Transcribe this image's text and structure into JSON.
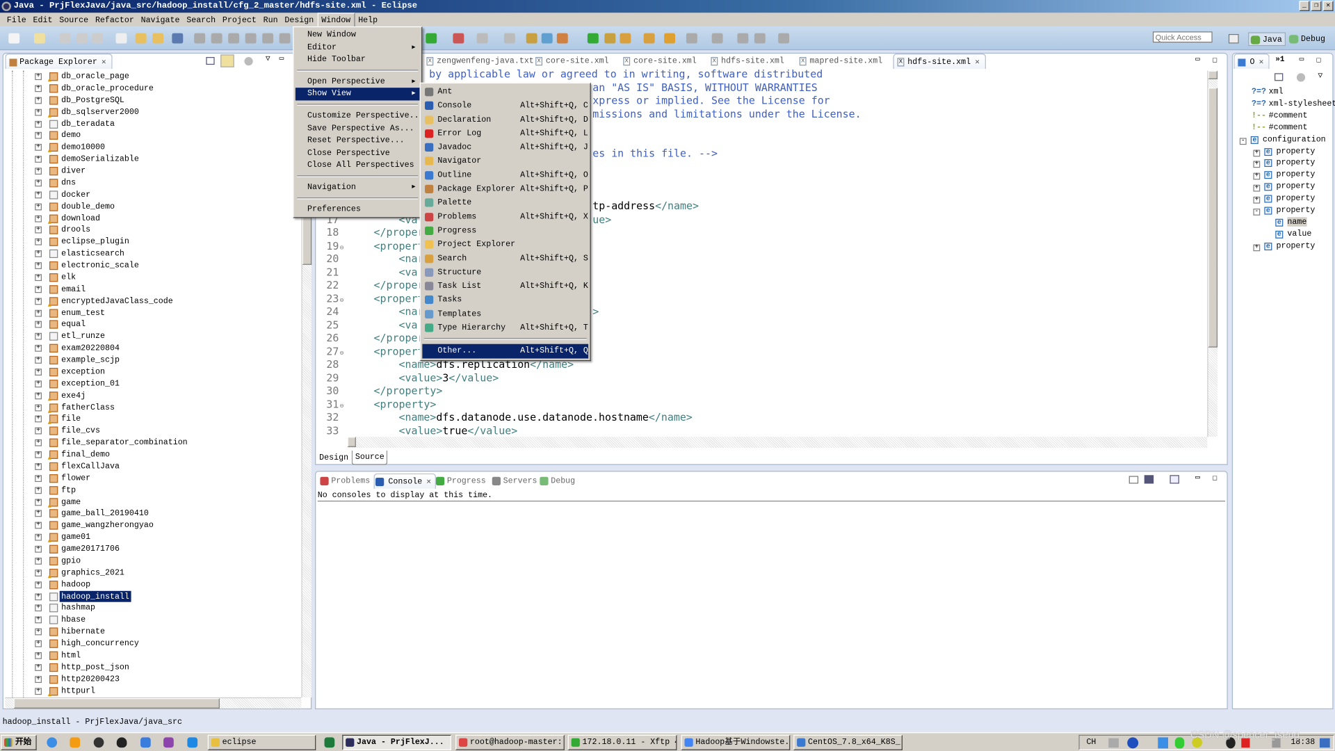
{
  "window": {
    "title": "Java - PrjFlexJava/java_src/hadoop_install/cfg_2_master/hdfs-site.xml - Eclipse"
  },
  "menubar": [
    "File",
    "Edit",
    "Source",
    "Refactor",
    "Navigate",
    "Search",
    "Project",
    "Run",
    "Design",
    "Window",
    "Help"
  ],
  "toolbar": {
    "quick_access_placeholder": "Quick Access",
    "perspectives": [
      {
        "label": "Java",
        "active": true
      },
      {
        "label": "Debug",
        "active": false
      }
    ]
  },
  "package_explorer": {
    "title": "Package Explorer",
    "items": [
      {
        "label": "db_oracle_page",
        "type": "project-warn"
      },
      {
        "label": "db_oracle_procedure",
        "type": "project"
      },
      {
        "label": "db_PostgreSQL",
        "type": "project"
      },
      {
        "label": "db_sqlserver2000",
        "type": "project-warn"
      },
      {
        "label": "db_teradata",
        "type": "folder"
      },
      {
        "label": "demo",
        "type": "project"
      },
      {
        "label": "demo10000",
        "type": "project-warn"
      },
      {
        "label": "demoSerializable",
        "type": "project"
      },
      {
        "label": "diver",
        "type": "project"
      },
      {
        "label": "dns",
        "type": "project"
      },
      {
        "label": "docker",
        "type": "folder"
      },
      {
        "label": "double_demo",
        "type": "project"
      },
      {
        "label": "download",
        "type": "project-warn"
      },
      {
        "label": "drools",
        "type": "project"
      },
      {
        "label": "eclipse_plugin",
        "type": "project"
      },
      {
        "label": "elasticsearch",
        "type": "folder"
      },
      {
        "label": "electronic_scale",
        "type": "project"
      },
      {
        "label": "elk",
        "type": "project"
      },
      {
        "label": "email",
        "type": "project"
      },
      {
        "label": "encryptedJavaClass_code",
        "type": "project-warn"
      },
      {
        "label": "enum_test",
        "type": "project"
      },
      {
        "label": "equal",
        "type": "project"
      },
      {
        "label": "etl_runze",
        "type": "folder"
      },
      {
        "label": "exam20220804",
        "type": "project"
      },
      {
        "label": "example_scjp",
        "type": "project"
      },
      {
        "label": "exception",
        "type": "project"
      },
      {
        "label": "exception_01",
        "type": "project"
      },
      {
        "label": "exe4j",
        "type": "project-warn"
      },
      {
        "label": "fatherClass",
        "type": "project-warn"
      },
      {
        "label": "file",
        "type": "project-warn"
      },
      {
        "label": "file_cvs",
        "type": "project"
      },
      {
        "label": "file_separator_combination",
        "type": "project"
      },
      {
        "label": "final_demo",
        "type": "project-warn"
      },
      {
        "label": "flexCallJava",
        "type": "project"
      },
      {
        "label": "flower",
        "type": "project"
      },
      {
        "label": "ftp",
        "type": "project"
      },
      {
        "label": "game",
        "type": "project-warn"
      },
      {
        "label": "game_ball_20190410",
        "type": "project"
      },
      {
        "label": "game_wangzherongyao",
        "type": "project"
      },
      {
        "label": "game01",
        "type": "project-warn"
      },
      {
        "label": "game20171706",
        "type": "project"
      },
      {
        "label": "gpio",
        "type": "project"
      },
      {
        "label": "graphics_2021",
        "type": "project-warn"
      },
      {
        "label": "hadoop",
        "type": "project"
      },
      {
        "label": "hadoop_install",
        "type": "folder",
        "selected": true
      },
      {
        "label": "hashmap",
        "type": "folder"
      },
      {
        "label": "hbase",
        "type": "folder"
      },
      {
        "label": "hibernate",
        "type": "project"
      },
      {
        "label": "high_concurrency",
        "type": "project"
      },
      {
        "label": "html",
        "type": "project"
      },
      {
        "label": "http_post_json",
        "type": "project"
      },
      {
        "label": "http20200423",
        "type": "project"
      },
      {
        "label": "httpurl",
        "type": "project-warn"
      }
    ]
  },
  "editor": {
    "tabs": [
      {
        "label": "zengwenfeng-java.txt",
        "active": false
      },
      {
        "label": "core-site.xml",
        "active": false
      },
      {
        "label": "core-site.xml",
        "active": false
      },
      {
        "label": "hdfs-site.xml",
        "active": false
      },
      {
        "label": "mapred-site.xml",
        "active": false
      },
      {
        "label": "hdfs-site.xml",
        "active": true
      }
    ],
    "lines": [
      {
        "num": "",
        "right6": [
          [
            "cmt",
            "by applicable law or agreed to in writing, software distributed"
          ]
        ]
      },
      {
        "num": "",
        "right": [
          [
            "cmt",
            "an \"AS IS\" BASIS, WITHOUT WARRANTIES"
          ]
        ]
      },
      {
        "num": "",
        "right": [
          [
            "cmt",
            "xpress or implied. See the License for"
          ]
        ]
      },
      {
        "num": "",
        "right": [
          [
            "cmt",
            "missions and limitations under the License."
          ]
        ]
      },
      {
        "num": ""
      },
      {
        "num": ""
      },
      {
        "num": "",
        "right": [
          [
            "cmt",
            "es in this file. -->"
          ]
        ]
      },
      {
        "num": ""
      },
      {
        "num": ""
      },
      {
        "num": ""
      },
      {
        "num": "16",
        "code": [
          [
            "tag",
            "    <nar"
          ]
        ],
        "right": [
          [
            "txt",
            "tp-address"
          ],
          [
            "tag",
            "</name>"
          ]
        ]
      },
      {
        "num": "17",
        "code": [
          [
            "tag",
            "    <va"
          ]
        ],
        "right": [
          [
            "tag",
            "ue>"
          ]
        ]
      },
      {
        "num": "18",
        "code": [
          [
            "tag",
            "</proper"
          ]
        ]
      },
      {
        "num": "19",
        "fold": true,
        "code": [
          [
            "tag",
            "<propert"
          ]
        ]
      },
      {
        "num": "20",
        "code": [
          [
            "tag",
            "    <nar"
          ]
        ]
      },
      {
        "num": "21",
        "code": [
          [
            "tag",
            "    <va"
          ]
        ]
      },
      {
        "num": "22",
        "code": [
          [
            "tag",
            "</proper"
          ]
        ]
      },
      {
        "num": "23",
        "fold": true,
        "code": [
          [
            "tag",
            "<propert"
          ]
        ]
      },
      {
        "num": "24",
        "code": [
          [
            "tag",
            "    <nar"
          ]
        ],
        "right": [
          [
            "tag",
            ">"
          ]
        ]
      },
      {
        "num": "25",
        "code": [
          [
            "tag",
            "    <va"
          ]
        ]
      },
      {
        "num": "26",
        "code": [
          [
            "tag",
            "</proper"
          ]
        ]
      },
      {
        "num": "27",
        "fold": true,
        "code": [
          [
            "tag",
            "<propert"
          ]
        ]
      },
      {
        "num": "28",
        "code": [
          [
            "tag",
            "    <name>"
          ],
          [
            "txt",
            "dfs.replication"
          ],
          [
            "tag",
            "</name>"
          ]
        ]
      },
      {
        "num": "29",
        "code": [
          [
            "tag",
            "    <value>"
          ],
          [
            "txt",
            "3"
          ],
          [
            "tag",
            "</value>"
          ]
        ]
      },
      {
        "num": "30",
        "code": [
          [
            "tag",
            "</property>"
          ]
        ]
      },
      {
        "num": "31",
        "fold": true,
        "code": [
          [
            "tag",
            "<property>"
          ]
        ]
      },
      {
        "num": "32",
        "code": [
          [
            "tag",
            "    <name>"
          ],
          [
            "txt",
            "dfs.datanode.use.datanode.hostname"
          ],
          [
            "tag",
            "</name>"
          ]
        ]
      },
      {
        "num": "33",
        "code": [
          [
            "tag",
            "    <value>"
          ],
          [
            "txt",
            "true"
          ],
          [
            "tag",
            "</value>"
          ]
        ]
      }
    ],
    "bottom_tabs": [
      {
        "label": "Design",
        "active": false
      },
      {
        "label": "Source",
        "active": true
      }
    ]
  },
  "console": {
    "tabs": [
      {
        "label": "Problems",
        "active": false
      },
      {
        "label": "Console",
        "active": true
      },
      {
        "label": "Progress",
        "active": false
      },
      {
        "label": "Servers",
        "active": false
      },
      {
        "label": "Debug",
        "active": false
      }
    ],
    "message": "No consoles to display at this time."
  },
  "outline": {
    "title": "O",
    "overflow": "»1",
    "items": [
      {
        "label": "xml",
        "kind": "pi",
        "level": 0
      },
      {
        "label": "xml-stylesheet",
        "kind": "pi",
        "level": 0
      },
      {
        "label": "#comment",
        "kind": "comment",
        "level": 0
      },
      {
        "label": "#comment",
        "kind": "comment",
        "level": 0
      },
      {
        "label": "configuration",
        "kind": "element",
        "level": 0,
        "toggle": "-"
      },
      {
        "label": "property",
        "kind": "element",
        "level": 1,
        "toggle": "+"
      },
      {
        "label": "property",
        "kind": "element",
        "level": 1,
        "toggle": "+"
      },
      {
        "label": "property",
        "kind": "element",
        "level": 1,
        "toggle": "+"
      },
      {
        "label": "property",
        "kind": "element",
        "level": 1,
        "toggle": "+"
      },
      {
        "label": "property",
        "kind": "element",
        "level": 1,
        "toggle": "+"
      },
      {
        "label": "property",
        "kind": "element",
        "level": 1,
        "toggle": "-"
      },
      {
        "label": "name",
        "kind": "element",
        "level": 2,
        "selected": true
      },
      {
        "label": "value",
        "kind": "element",
        "level": 2
      },
      {
        "label": "property",
        "kind": "element",
        "level": 1,
        "toggle": "+"
      }
    ]
  },
  "window_menu": [
    {
      "label": "New Window"
    },
    {
      "label": "Editor",
      "submenu": true
    },
    {
      "label": "Hide Toolbar"
    },
    {
      "sep": true
    },
    {
      "label": "Open Perspective",
      "submenu": true
    },
    {
      "label": "Show View",
      "submenu": true,
      "highlighted": true
    },
    {
      "sep": true
    },
    {
      "label": "Customize Perspective..."
    },
    {
      "label": "Save Perspective As..."
    },
    {
      "label": "Reset Perspective..."
    },
    {
      "label": "Close Perspective"
    },
    {
      "label": "Close All Perspectives"
    },
    {
      "sep": true
    },
    {
      "label": "Navigation",
      "submenu": true
    },
    {
      "sep": true
    },
    {
      "label": "Preferences"
    }
  ],
  "show_view_menu": [
    {
      "label": "Ant",
      "icon": "ant-icon",
      "color": "#777"
    },
    {
      "label": "Console",
      "shortcut": "Alt+Shift+Q, C",
      "icon": "console-icon",
      "color": "#2a5db0"
    },
    {
      "label": "Declaration",
      "shortcut": "Alt+Shift+Q, D",
      "icon": "declaration-icon",
      "color": "#e8c060"
    },
    {
      "label": "Error Log",
      "shortcut": "Alt+Shift+Q, L",
      "icon": "error-log-icon",
      "color": "#d22"
    },
    {
      "label": "Javadoc",
      "shortcut": "Alt+Shift+Q, J",
      "icon": "javadoc-icon",
      "color": "#3a6ec0"
    },
    {
      "label": "Navigator",
      "icon": "navigator-icon",
      "color": "#e8b850"
    },
    {
      "label": "Outline",
      "shortcut": "Alt+Shift+Q, O",
      "icon": "outline-icon",
      "color": "#3a7ad0"
    },
    {
      "label": "Package Explorer",
      "shortcut": "Alt+Shift+Q, P",
      "icon": "package-explorer-icon",
      "color": "#c08040"
    },
    {
      "label": "Palette",
      "icon": "palette-icon",
      "color": "#6a9"
    },
    {
      "label": "Problems",
      "shortcut": "Alt+Shift+Q, X",
      "icon": "problems-icon",
      "color": "#c44"
    },
    {
      "label": "Progress",
      "icon": "progress-icon",
      "color": "#4a4"
    },
    {
      "label": "Project Explorer",
      "icon": "project-explorer-icon",
      "color": "#f0c050"
    },
    {
      "label": "Search",
      "shortcut": "Alt+Shift+Q, S",
      "icon": "search-icon",
      "color": "#d9a040"
    },
    {
      "label": "Structure",
      "icon": "structure-icon",
      "color": "#8899bb"
    },
    {
      "label": "Task List",
      "shortcut": "Alt+Shift+Q, K",
      "icon": "task-list-icon",
      "color": "#889"
    },
    {
      "label": "Tasks",
      "icon": "tasks-icon",
      "color": "#48c"
    },
    {
      "label": "Templates",
      "icon": "templates-icon",
      "color": "#69c"
    },
    {
      "label": "Type Hierarchy",
      "shortcut": "Alt+Shift+Q, T",
      "icon": "type-hierarchy-icon",
      "color": "#4a8"
    },
    {
      "sep": true
    },
    {
      "label": "Other...",
      "shortcut": "Alt+Shift+Q, Q",
      "highlighted": true
    }
  ],
  "statusbar": {
    "text": "hadoop_install - PrjFlexJava/java_src"
  },
  "taskbar": {
    "start": "开始",
    "buttons": [
      {
        "label": "eclipse",
        "color": "#e8c040"
      },
      {
        "label": "Java - PrjFlexJ...",
        "color": "#2c2d5a",
        "pressed": true
      },
      {
        "label": "root@hadoop-master:...",
        "color": "#d44"
      },
      {
        "label": "172.18.0.11 - Xftp 4",
        "color": "#3a3"
      },
      {
        "label": "Hadoop基于Windowste...",
        "color": "#4285f4"
      },
      {
        "label": "CentOS_7.8_x64_K8S_...",
        "color": "#3a7ad0"
      }
    ],
    "lang": "CH",
    "clock": "18:38"
  },
  "watermark": "CSDN @spencer_tseng",
  "colors": {
    "selection": "#0a246a",
    "xml_tag": "#3f7f7f",
    "xml_comment": "#3f5fbf",
    "toolbar": "#b4cce4"
  }
}
